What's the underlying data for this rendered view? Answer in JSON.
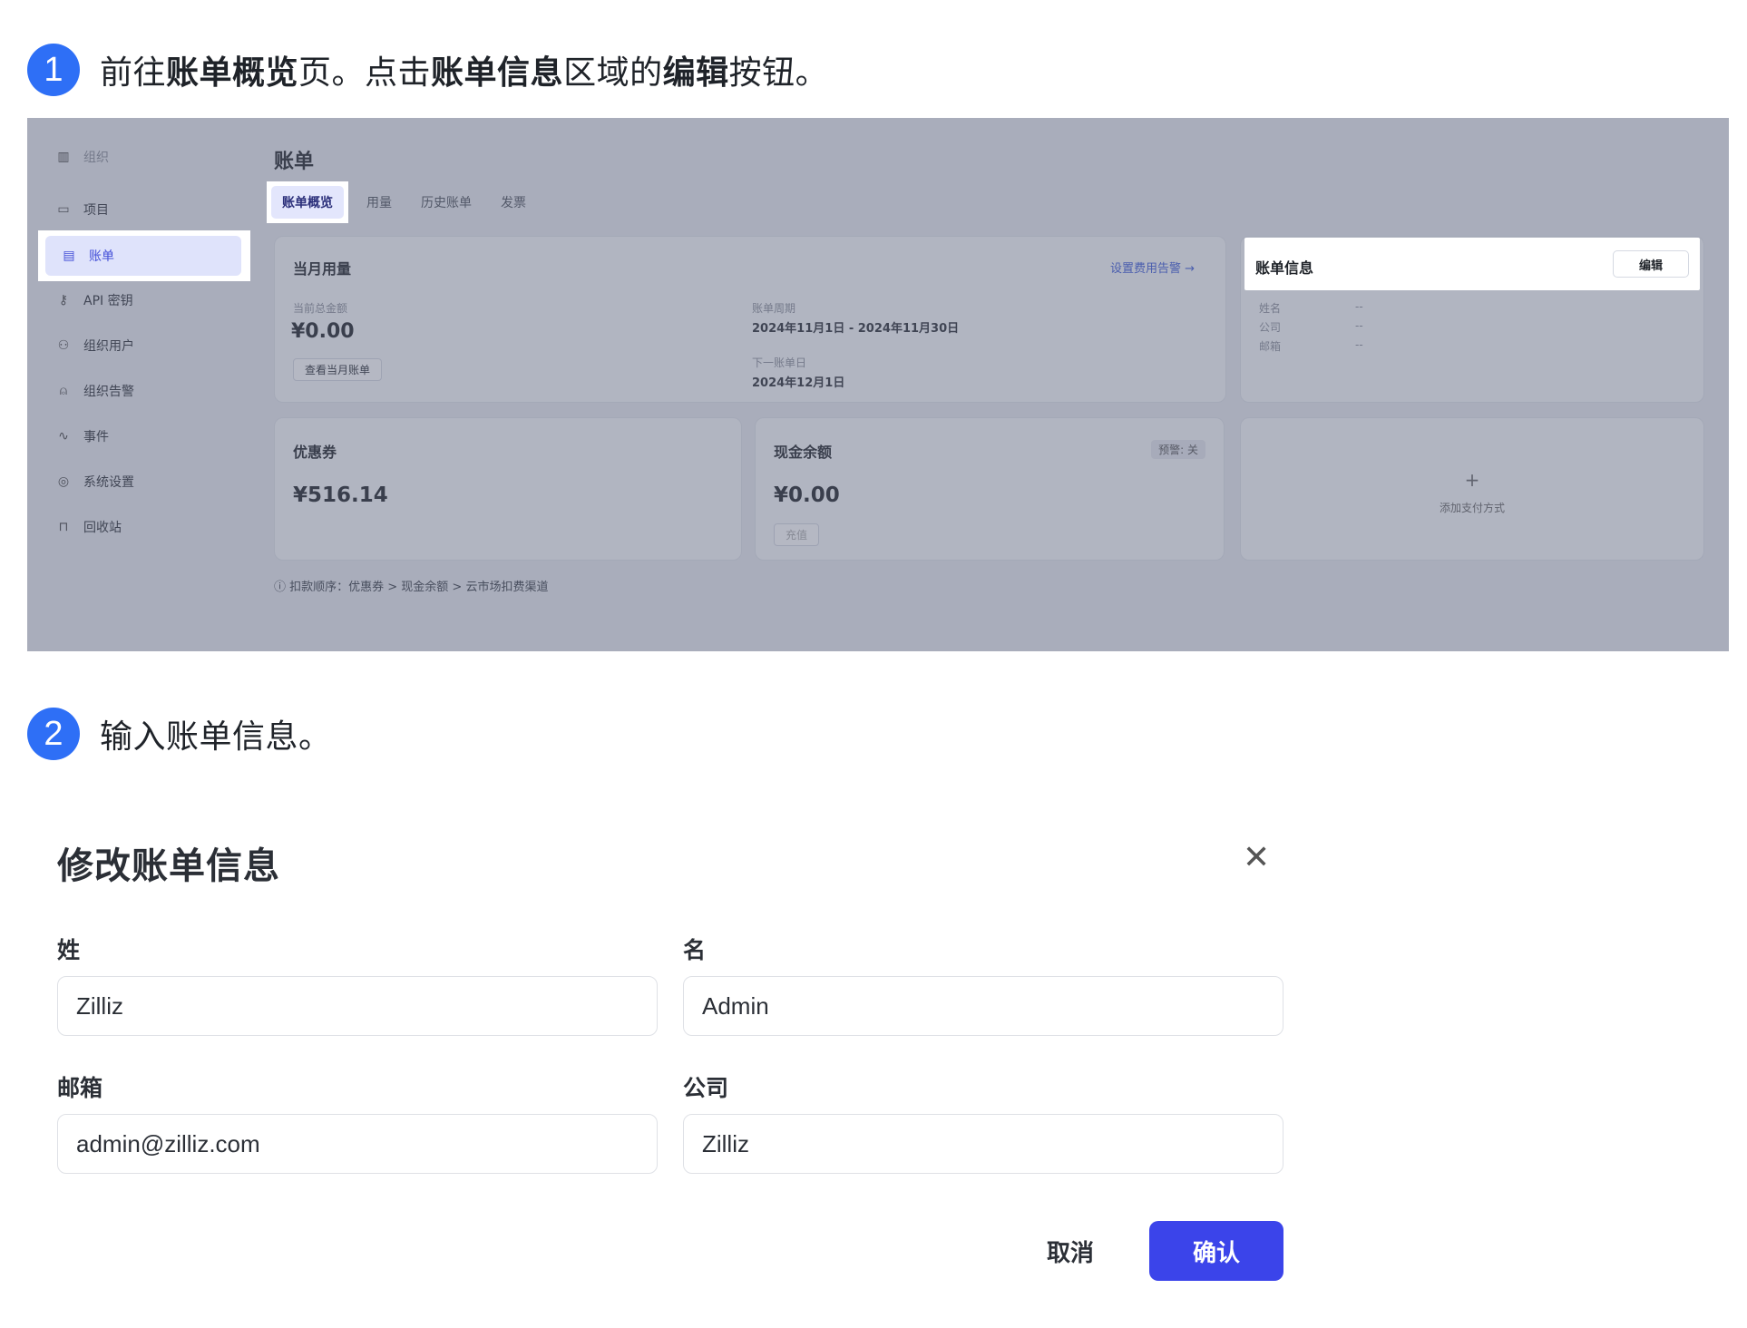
{
  "step1": {
    "num": "1",
    "parts": [
      "前往",
      "账单概览",
      "页。点击",
      "账单信息",
      "区域的",
      "编辑",
      "按钮。"
    ]
  },
  "step2": {
    "num": "2",
    "text": "输入账单信息。"
  },
  "screenshot": {
    "sidebar": {
      "org": "组织",
      "items": [
        {
          "label": "项目",
          "icon": "folder-icon"
        },
        {
          "label": "账单",
          "icon": "bill-icon",
          "active": true
        },
        {
          "label": "API 密钥",
          "icon": "key-icon"
        },
        {
          "label": "组织用户",
          "icon": "users-icon"
        },
        {
          "label": "组织告警",
          "icon": "alarm-icon"
        },
        {
          "label": "事件",
          "icon": "activity-icon"
        },
        {
          "label": "系统设置",
          "icon": "settings-icon"
        },
        {
          "label": "回收站",
          "icon": "trash-icon"
        }
      ]
    },
    "title": "账单",
    "tabs": [
      "账单概览",
      "用量",
      "历史账单",
      "发票"
    ],
    "usage_card": {
      "title": "当月用量",
      "alert_link": "设置费用告警 →",
      "total_label": "当前总金额",
      "total_value": "¥0.00",
      "view_button": "查看当月账单",
      "period_label": "账单周期",
      "period_value": "2024年11月1日 - 2024年11月30日",
      "next_label": "下一账单日",
      "next_value": "2024年12月1日"
    },
    "billing_info": {
      "title": "账单信息",
      "edit_button": "编辑",
      "rows": [
        {
          "label": "姓名",
          "value": "--"
        },
        {
          "label": "公司",
          "value": "--"
        },
        {
          "label": "邮箱",
          "value": "--"
        }
      ]
    },
    "coupon_card": {
      "title": "优惠券",
      "value": "¥516.14"
    },
    "cash_card": {
      "title": "现金余额",
      "badge": "预警: 关",
      "value": "¥0.00",
      "button": "充值"
    },
    "payment_card": {
      "plus": "+",
      "label": "添加支付方式"
    },
    "footnote": "扣款顺序：优惠券 > 现金余额 > 云市场扣费渠道"
  },
  "dialog": {
    "title": "修改账单信息",
    "fields": {
      "last_name": {
        "label": "姓",
        "value": "Zilliz"
      },
      "first_name": {
        "label": "名",
        "value": "Admin"
      },
      "email": {
        "label": "邮箱",
        "value": "admin@zilliz.com"
      },
      "company": {
        "label": "公司",
        "value": "Zilliz"
      }
    },
    "cancel": "取消",
    "confirm": "确认"
  },
  "colors": {
    "step_badge": "#2e6ff6",
    "primary_button": "#3b44ea",
    "active_nav": "#4450d8"
  }
}
